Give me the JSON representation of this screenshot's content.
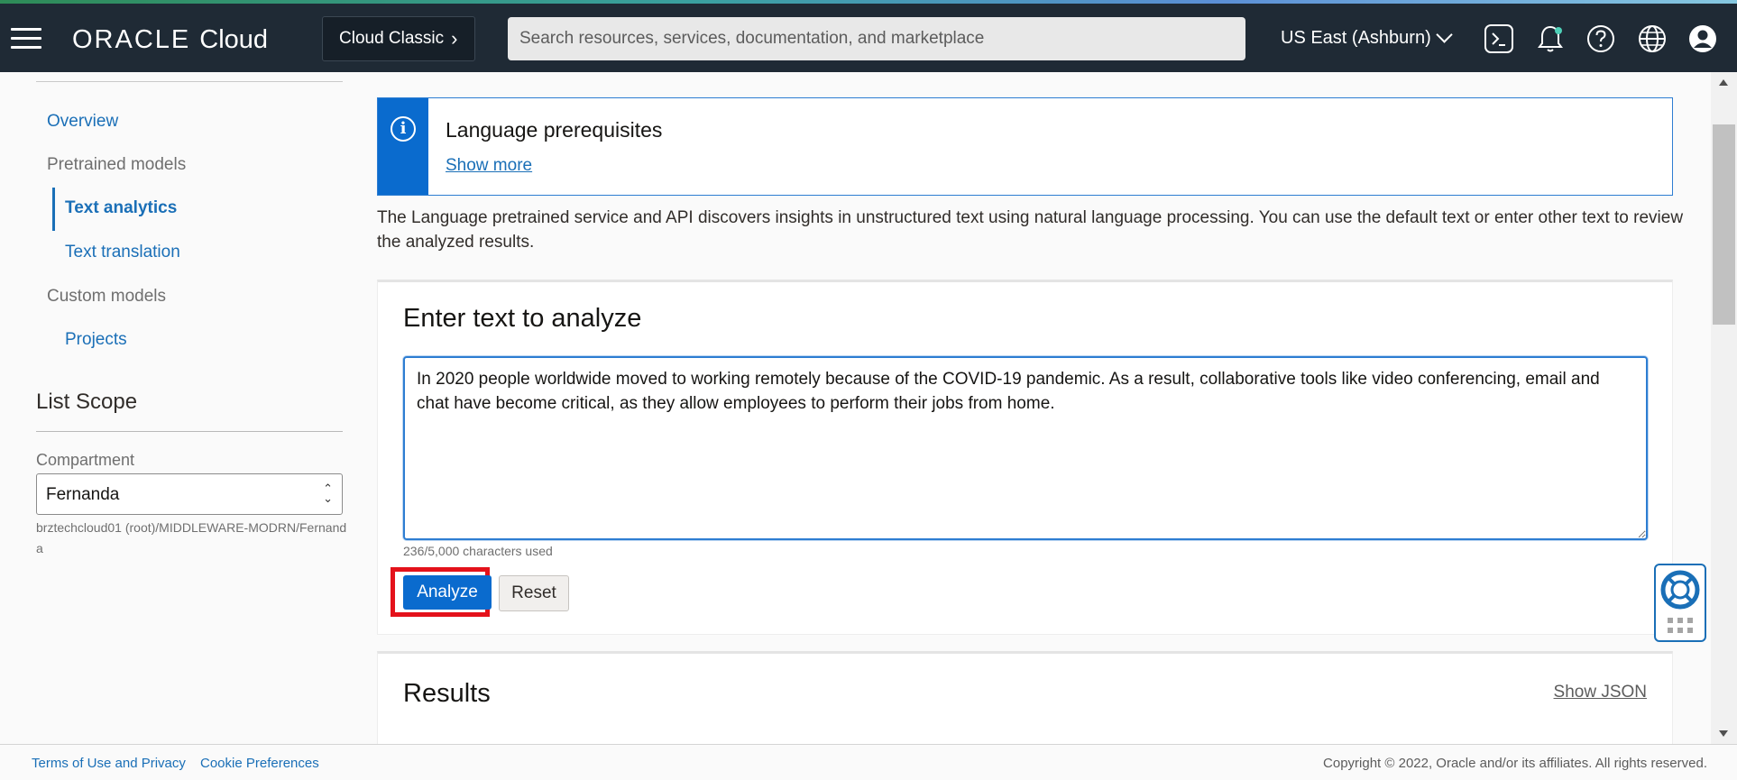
{
  "header": {
    "brand_oracle": "ORACLE",
    "brand_cloud": "Cloud",
    "classic_label": "Cloud Classic",
    "search_placeholder": "Search resources, services, documentation, and marketplace",
    "region": "US East (Ashburn)",
    "icons": [
      "menu-icon",
      "cloud-shell-icon",
      "notifications-bell-icon",
      "help-icon",
      "language-globe-icon",
      "user-avatar-icon"
    ]
  },
  "sidebar": {
    "overview": "Overview",
    "pretrained_group": "Pretrained models",
    "text_analytics": "Text analytics",
    "text_translation": "Text translation",
    "custom_group": "Custom models",
    "projects": "Projects",
    "list_scope_title": "List Scope",
    "compartment_label": "Compartment",
    "compartment_value": "Fernanda",
    "compartment_path": "brztechcloud01 (root)/MIDDLEWARE-MODRN/Fernanda"
  },
  "main": {
    "info_title": "Language prerequisites",
    "info_link": "Show more",
    "description": "The Language pretrained service and API discovers insights in unstructured text using natural language processing. You can use the default text or enter other text to review the analyzed results.",
    "input_card": {
      "title": "Enter text to analyze",
      "text_value": "In 2020 people worldwide moved to working remotely because of the COVID-19 pandemic. As a result, collaborative tools like video conferencing, email and chat have become critical, as they allow employees to perform their jobs from home.",
      "char_count": "236/5,000 characters used",
      "analyze_label": "Analyze",
      "reset_label": "Reset"
    },
    "results": {
      "title": "Results",
      "show_json": "Show JSON"
    }
  },
  "footer": {
    "terms": "Terms of Use and Privacy",
    "cookies": "Cookie Preferences",
    "copyright": "Copyright © 2022, Oracle and/or its affiliates. All rights reserved."
  },
  "colors": {
    "header_bg": "#1f2a35",
    "link_blue": "#1a6fb7",
    "primary_button": "#0a6bce",
    "highlight_red": "#e4121b"
  }
}
